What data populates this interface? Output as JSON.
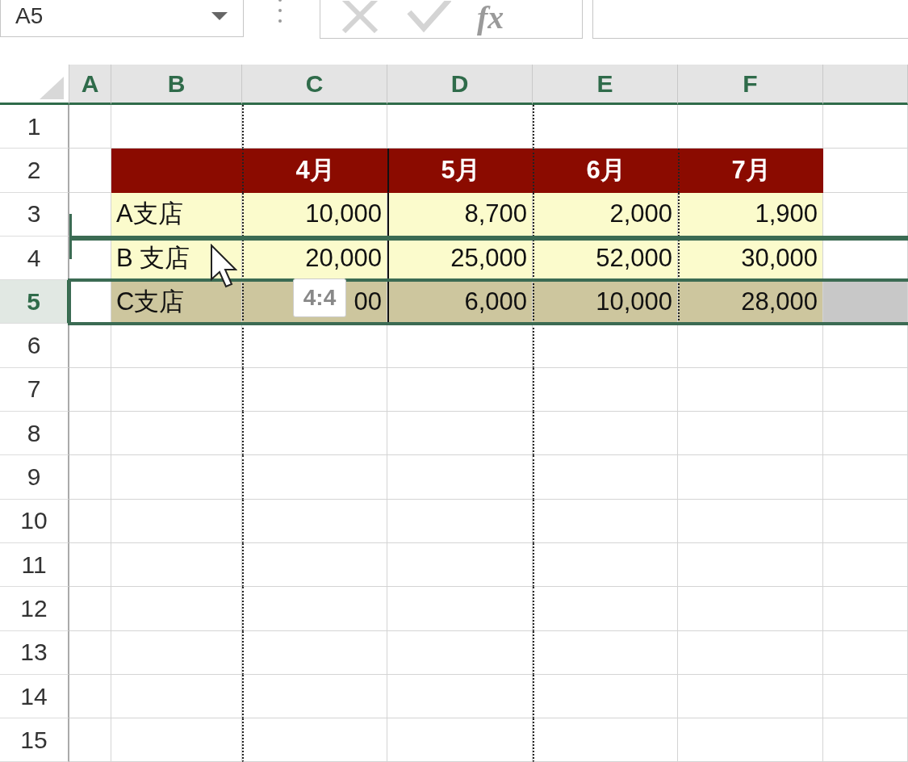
{
  "name_box": {
    "value": "A5"
  },
  "formula_bar": {
    "function_label": "fx"
  },
  "columns": [
    {
      "label": "A"
    },
    {
      "label": "B"
    },
    {
      "label": "C"
    },
    {
      "label": "D"
    },
    {
      "label": "E"
    },
    {
      "label": "F"
    }
  ],
  "rows": [
    {
      "number": "1",
      "selected": false
    },
    {
      "number": "2",
      "selected": false
    },
    {
      "number": "3",
      "selected": false
    },
    {
      "number": "4",
      "selected": false
    },
    {
      "number": "5",
      "selected": true
    },
    {
      "number": "6",
      "selected": false
    },
    {
      "number": "7",
      "selected": false
    },
    {
      "number": "8",
      "selected": false
    },
    {
      "number": "9",
      "selected": false
    },
    {
      "number": "10",
      "selected": false
    },
    {
      "number": "11",
      "selected": false
    },
    {
      "number": "12",
      "selected": false
    },
    {
      "number": "13",
      "selected": false
    },
    {
      "number": "14",
      "selected": false
    },
    {
      "number": "15",
      "selected": false
    }
  ],
  "table": {
    "header": [
      "4月",
      "5月",
      "6月",
      "7月"
    ],
    "rows": [
      {
        "label": "A支店",
        "values": [
          "10,000",
          "8,700",
          "2,000",
          "1,900"
        ]
      },
      {
        "label": "B 支店",
        "values": [
          "20,000",
          "25,000",
          "52,000",
          "30,000"
        ]
      },
      {
        "label": "C支店",
        "values": [
          "00",
          "6,000",
          "10,000",
          "28,000"
        ]
      }
    ]
  },
  "drag": {
    "tooltip": "4:4"
  }
}
